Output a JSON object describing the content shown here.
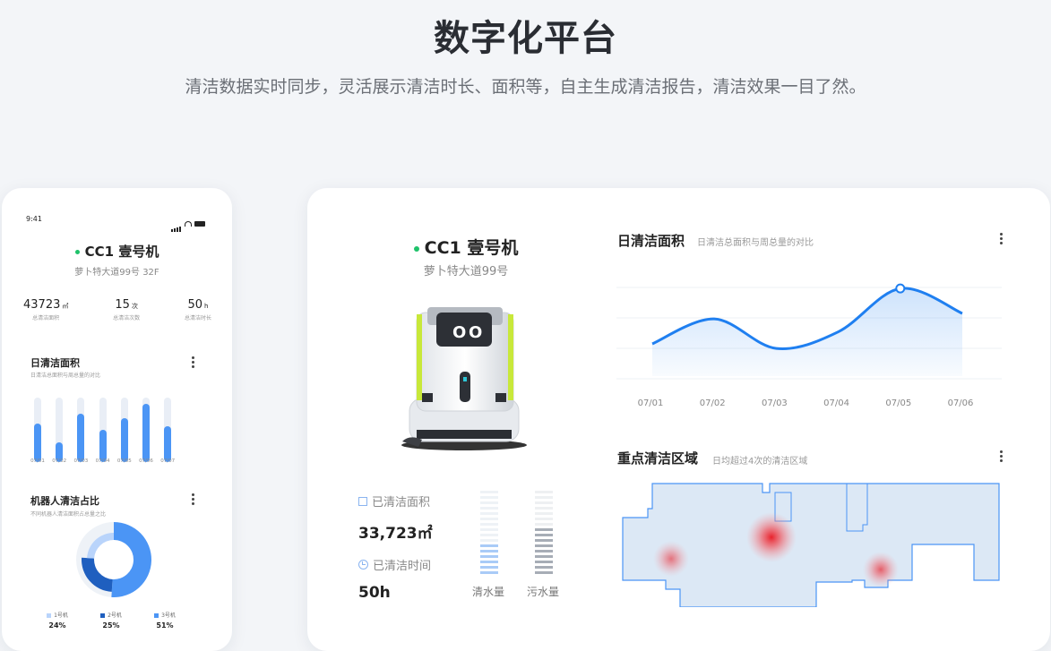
{
  "hero": {
    "title": "数字化平台",
    "subtitle": "清洁数据实时同步，灵活展示清洁时长、面积等，自主生成清洁报告，清洁效果一目了然。"
  },
  "phone": {
    "time": "9:41",
    "robot_name": "CC1 壹号机",
    "address": "萝卜特大道99号 32F",
    "stats": [
      {
        "value": "43723",
        "unit": "㎡",
        "label": "总清洁面积"
      },
      {
        "value": "15",
        "unit": "次",
        "label": "总清洁次数"
      },
      {
        "value": "50",
        "unit": "h",
        "label": "总清洁时长"
      }
    ],
    "daily": {
      "title": "日清洁面积",
      "subtitle": "日清洁总面积与周总量的对比",
      "dates": [
        "07/01",
        "07/02",
        "07/03",
        "07/04",
        "07/05",
        "07/06",
        "07/07"
      ],
      "levels": [
        0.6,
        0.3,
        0.75,
        0.5,
        0.68,
        0.9,
        0.56
      ]
    },
    "share": {
      "title": "机器人清洁占比",
      "subtitle": "不同机器人清洁面积占总量之比",
      "items": [
        {
          "name": "1号机",
          "pct": "24%",
          "value": 24,
          "color": "#b9d4fb"
        },
        {
          "name": "2号机",
          "pct": "25%",
          "value": 25,
          "color": "#1f5fbf"
        },
        {
          "name": "3号机",
          "pct": "51%",
          "value": 51,
          "color": "#4b95f5"
        }
      ]
    }
  },
  "desktop": {
    "robot_name": "CC1 壹号机",
    "address": "萝卜特大道99号",
    "area_label": "已清洁面积",
    "area_value": "33,723㎡",
    "time_label": "已清洁时间",
    "time_value": "50h",
    "clean_water_label": "清水量",
    "dirty_water_label": "污水量",
    "clean_water_level": 0.4,
    "dirty_water_level": 0.55,
    "colors": {
      "accent": "#1f7ff0",
      "online": "#1fc26a",
      "heat": "#e8222c"
    },
    "daily_chart": {
      "title": "日清洁面积",
      "subtitle": "日清洁总面积与周总量的对比"
    },
    "heatmap": {
      "title": "重点清洁区域",
      "subtitle": "日均超过4次的清洁区域"
    }
  },
  "chart_data": [
    {
      "type": "bar",
      "categories": [
        "07/01",
        "07/02",
        "07/03",
        "07/04",
        "07/05",
        "07/06",
        "07/07"
      ],
      "values": [
        0.6,
        0.3,
        0.75,
        0.5,
        0.68,
        0.9,
        0.56
      ],
      "title": "日清洁面积"
    },
    {
      "type": "area",
      "x": [
        "07/01",
        "07/02",
        "07/03",
        "07/04",
        "07/05",
        "07/06"
      ],
      "y": [
        0.35,
        0.62,
        0.3,
        0.48,
        0.95,
        0.68
      ],
      "title": "日清洁面积",
      "ylim": [
        0,
        1
      ],
      "highlight": "07/05"
    },
    {
      "type": "pie",
      "categories": [
        "1号机",
        "2号机",
        "3号机"
      ],
      "values": [
        24,
        25,
        51
      ],
      "title": "机器人清洁占比"
    }
  ]
}
